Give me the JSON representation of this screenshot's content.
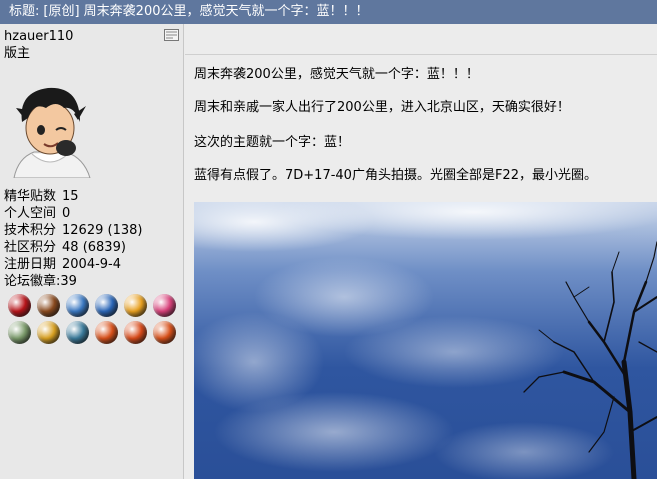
{
  "header": {
    "prefix": "标题:",
    "title": "[原创] 周末奔袭200公里，感觉天气就一个字：蓝！！！"
  },
  "user": {
    "name": "hzauer110",
    "role": "版主",
    "stats": [
      {
        "label": "精华贴数",
        "value": "15"
      },
      {
        "label": "个人空间",
        "value": "0"
      },
      {
        "label": "技术积分",
        "value": "12629 (138)"
      },
      {
        "label": "社区积分",
        "value": "48 (6839)"
      },
      {
        "label": "注册日期",
        "value": "2004-9-4"
      },
      {
        "label": "论坛徽章:",
        "value": "39"
      }
    ],
    "badges_row1": [
      "#b8141a",
      "#8a4a1e",
      "#3a78c2",
      "#2a66b8",
      "#e8a020",
      "#d8407a"
    ],
    "badges_row2": [
      "#7a9a6a",
      "#d8a020",
      "#3a7a9a",
      "#d8501a",
      "#d84a1a",
      "#d8501a"
    ]
  },
  "post": {
    "lines": [
      "周末奔袭200公里，感觉天气就一个字：蓝！！！",
      "周末和亲戚一家人出行了200公里，进入北京山区，天确实很好！",
      "这次的主题就一个字：蓝！",
      "蓝得有点假了。7D+17-40广角头拍摄。光圈全部是F22，最小光圈。"
    ]
  },
  "colors": {
    "titlebar": "#5f779e",
    "sky": "#2f5aa2"
  }
}
